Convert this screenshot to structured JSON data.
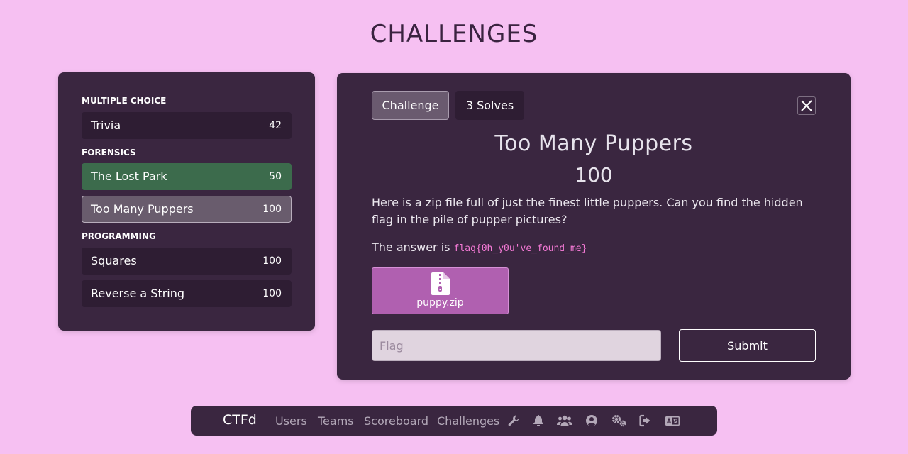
{
  "page": {
    "title": "CHALLENGES"
  },
  "categories": [
    {
      "name": "MULTIPLE CHOICE",
      "challenges": [
        {
          "name": "Trivia",
          "points": "42"
        }
      ]
    },
    {
      "name": "FORENSICS",
      "challenges": [
        {
          "name": "The Lost Park",
          "points": "50",
          "state": "solved"
        },
        {
          "name": "Too Many Puppers",
          "points": "100",
          "state": "active"
        }
      ]
    },
    {
      "name": "PROGRAMMING",
      "challenges": [
        {
          "name": "Squares",
          "points": "100"
        },
        {
          "name": "Reverse a String",
          "points": "100"
        }
      ]
    }
  ],
  "modal": {
    "tabs": {
      "challenge": "Challenge",
      "solves": "3 Solves"
    },
    "name": "Too Many Puppers",
    "value": "100",
    "description": "Here is a zip file full of just the finest little puppers. Can you find the hidden flag in the pile of pupper pictures?",
    "answer_prefix": "The answer is",
    "answer_flag": "flag{0h_y0u've_found_me}",
    "file": {
      "name": "puppy.zip",
      "icon": "file-zip-icon"
    },
    "flag_placeholder": "Flag",
    "submit_label": "Submit"
  },
  "nav": {
    "brand": "CTFd",
    "links": [
      "Users",
      "Teams",
      "Scoreboard",
      "Challenges"
    ],
    "icons": [
      "wrench-icon",
      "bell-icon",
      "users-icon",
      "user-circle-icon",
      "cogs-icon",
      "logout-icon",
      "language-icon"
    ]
  },
  "colors": {
    "background": "#f6c0f2",
    "panel": "#3a2640",
    "item": "#2e1d33",
    "solved": "#3c6b4c",
    "active": "#695c6d",
    "file_button": "#b060b0",
    "flag_code": "#f57ad6"
  }
}
